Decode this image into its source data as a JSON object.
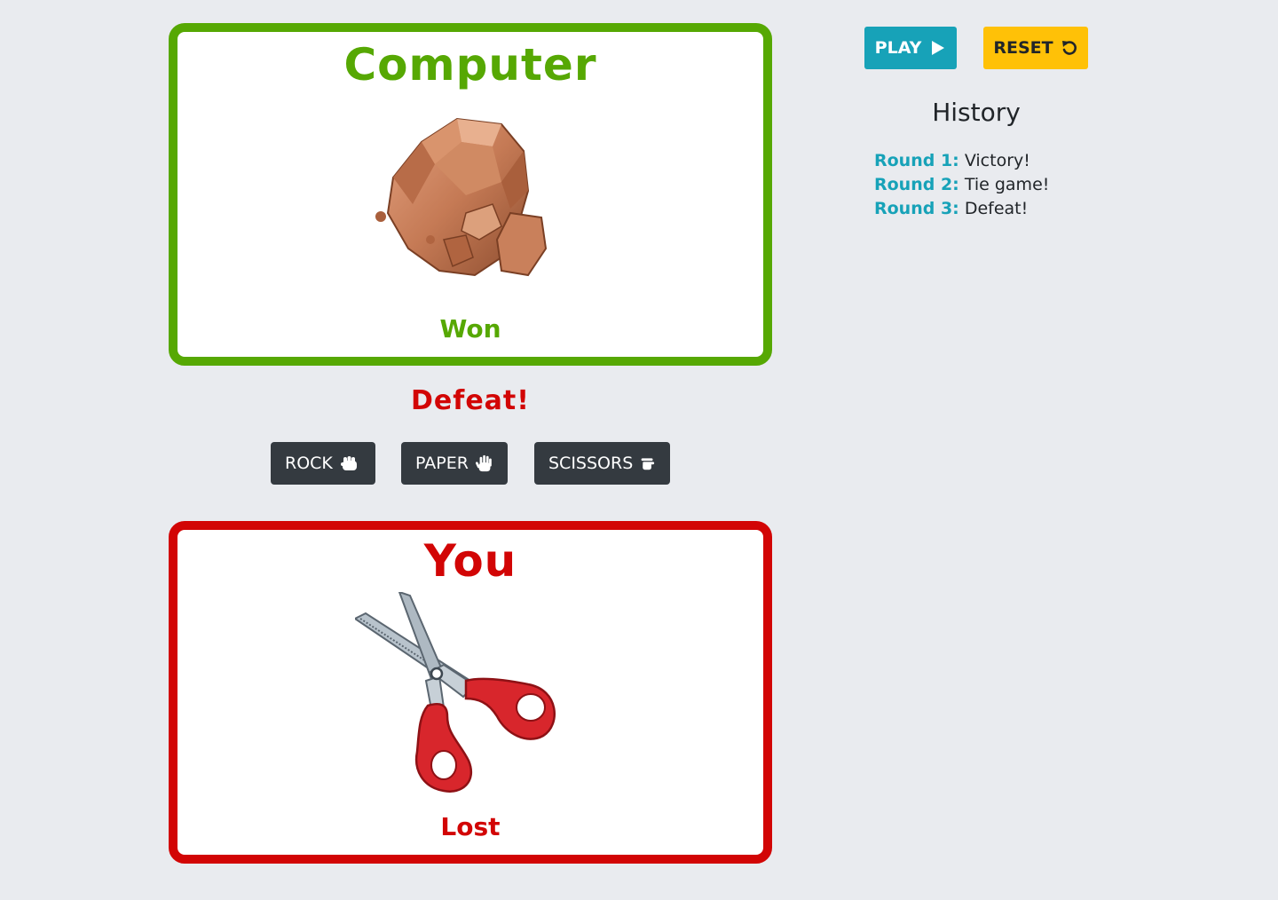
{
  "computer": {
    "title": "Computer",
    "status": "Won",
    "choice_icon": "rock-image"
  },
  "player": {
    "title": "You",
    "status": "Lost",
    "choice_icon": "scissors-image"
  },
  "result_text": "Defeat!",
  "choices": [
    {
      "label": "ROCK",
      "icon": "hand-rock-icon"
    },
    {
      "label": "PAPER",
      "icon": "hand-paper-icon"
    },
    {
      "label": "SCISSORS",
      "icon": "hand-scissors-icon"
    }
  ],
  "controls": {
    "play_label": "PLAY",
    "play_icon": "play-icon",
    "reset_label": "RESET",
    "reset_icon": "undo-icon"
  },
  "history": {
    "title": "History",
    "rounds": [
      {
        "label": "Round 1:",
        "outcome": "Victory!"
      },
      {
        "label": "Round 2:",
        "outcome": "Tie game!"
      },
      {
        "label": "Round 3:",
        "outcome": "Defeat!"
      }
    ]
  },
  "colors": {
    "win": "#56a803",
    "lose": "#d20505",
    "dark_button": "#343a40",
    "play_button": "#17a2b8",
    "reset_button": "#ffc107",
    "background": "#e9ebef"
  }
}
